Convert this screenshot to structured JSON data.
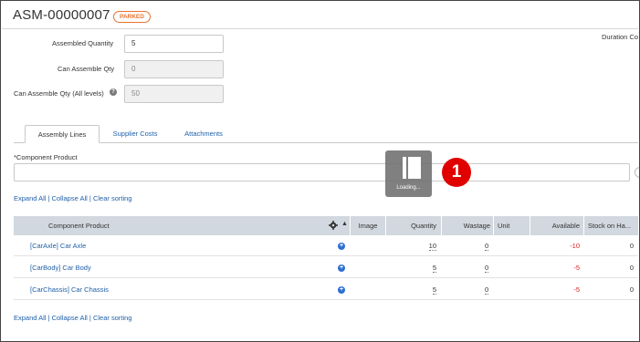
{
  "header": {
    "title": "ASM-00000007",
    "status": "PARKED",
    "duration_label": "Duration Co"
  },
  "fields": {
    "assembled_quantity": {
      "label": "Assembled Quantity",
      "value": "5"
    },
    "can_assemble_qty": {
      "label": "Can Assemble Qty",
      "value": "0"
    },
    "can_assemble_all": {
      "label": "Can Assemble Qty (All levels)",
      "value": "50"
    }
  },
  "tabs": [
    {
      "label": "Assembly Lines",
      "active": true
    },
    {
      "label": "Supplier Costs",
      "active": false
    },
    {
      "label": "Attachments",
      "active": false
    }
  ],
  "component_field": {
    "label": "*Component Product",
    "value": ""
  },
  "links": {
    "expand_all": "Expand All",
    "collapse_all": "Collapse All",
    "clear_sorting": "Clear sorting",
    "separator": "|"
  },
  "loading": {
    "text": "Loading..."
  },
  "step_badge": "1",
  "grid": {
    "columns": [
      "Component Product",
      "Image",
      "Quantity",
      "Wastage",
      "Unit",
      "Available",
      "Stock on Ha..."
    ],
    "rows": [
      {
        "product": "[CarAxle] Car Axle",
        "quantity": "10",
        "wastage": "0",
        "unit": "",
        "available": "-10",
        "stock": "0"
      },
      {
        "product": "[CarBody] Car Body",
        "quantity": "5",
        "wastage": "0",
        "unit": "",
        "available": "-5",
        "stock": "0"
      },
      {
        "product": "[CarChassis] Car Chassis",
        "quantity": "5",
        "wastage": "0",
        "unit": "",
        "available": "-5",
        "stock": "0"
      }
    ]
  },
  "icons": {
    "help": "question-icon",
    "gear": "gear-icon",
    "sort": "sort-up-icon",
    "add": "plus-circle-icon",
    "loading": "loading-icon"
  },
  "colors": {
    "status_orange": "#e8742f",
    "link_blue": "#1f5fa8",
    "grid_header": "#d2d8df",
    "negative_red": "#e02020",
    "badge_red": "#e00000"
  }
}
